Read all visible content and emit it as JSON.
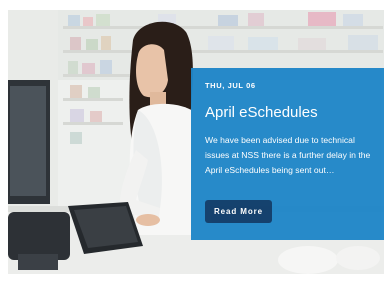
{
  "post": {
    "date": "THU, JUL 06",
    "title": "April eSchedules",
    "excerpt": "We have been advised due to technical issues at NSS there is a further delay in the April eSchedules being sent out…",
    "read_more_label": "Read More"
  },
  "colors": {
    "overlay": "#1f86c8",
    "button": "#0d3b69"
  },
  "image": {
    "subject": "pharmacist-typing-at-keyboard-photo"
  }
}
